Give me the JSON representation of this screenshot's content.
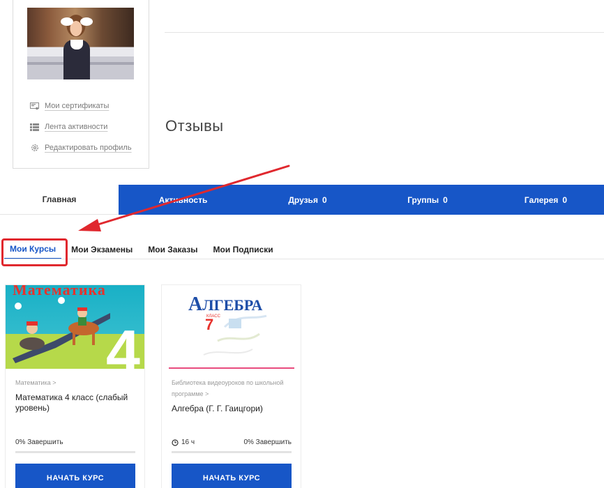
{
  "profile": {
    "links": [
      {
        "icon": "certificate-icon",
        "label": "Мои сертификаты"
      },
      {
        "icon": "list-icon",
        "label": "Лента активности"
      },
      {
        "icon": "gear-icon",
        "label": "Редактировать профиль"
      }
    ]
  },
  "reviews": {
    "title": "Отзывы"
  },
  "tabs": [
    {
      "label": "Главная",
      "count": "",
      "active": true
    },
    {
      "label": "Активность",
      "count": "",
      "active": false
    },
    {
      "label": "Друзья",
      "count": "0",
      "active": false
    },
    {
      "label": "Группы",
      "count": "0",
      "active": false
    },
    {
      "label": "Галерея",
      "count": "0",
      "active": false
    }
  ],
  "subtabs": [
    {
      "label": "Мои Курсы",
      "active": true
    },
    {
      "label": "Мои Экзамены",
      "active": false
    },
    {
      "label": "Мои Заказы",
      "active": false
    },
    {
      "label": "Мои Подписки",
      "active": false
    }
  ],
  "courses": [
    {
      "cover_title": "Математика",
      "cover_grade": "4",
      "crumb": "Математика >",
      "title": "Математика 4 класс (слабый уровень)",
      "duration": "",
      "progress_label": "0% Завершить",
      "progress": 0,
      "button": "НАЧАТЬ КУРС"
    },
    {
      "cover_title_first": "А",
      "cover_title_rest": "ЛГЕБРА",
      "cover_grade_word": "КЛАСС",
      "cover_grade": "7",
      "crumb": "Библиотека видеоуроков по школьной программе >",
      "title": "Алгебра (Г. Г. Гаицгори)",
      "duration": "16 ч",
      "progress_label": "0% Завершить",
      "progress": 0,
      "button": "НАЧАТЬ КУРС"
    }
  ],
  "colors": {
    "brand": "#1756c7",
    "annotation": "#e0282e"
  }
}
